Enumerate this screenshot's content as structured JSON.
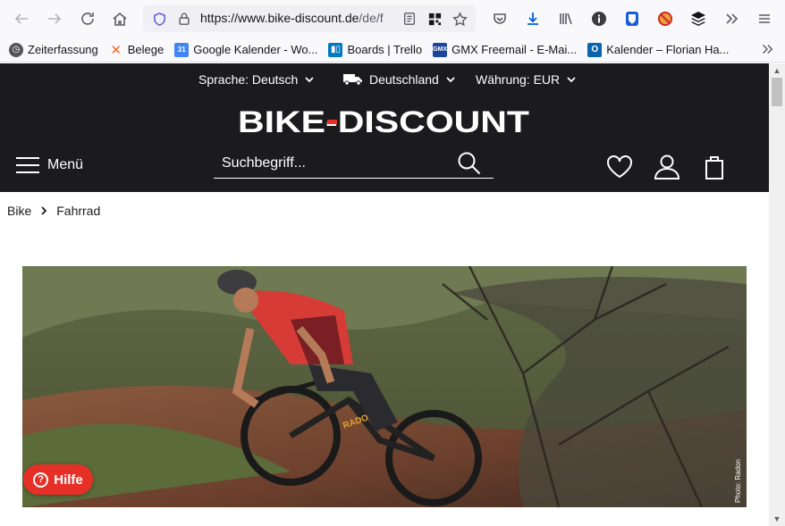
{
  "browser": {
    "url_host": "https://www.bike-discount.de",
    "url_path": "/de/f",
    "bookmarks": [
      {
        "label": "Zeiterfassung",
        "icon": "clock-icon",
        "color": "#555555"
      },
      {
        "label": "Belege",
        "icon": "x-logo-icon",
        "color": "#f26b21"
      },
      {
        "label": "Google Kalender - Wo...",
        "icon": "google-calendar-icon",
        "color": "#4285f4"
      },
      {
        "label": "Boards | Trello",
        "icon": "trello-icon",
        "color": "#0079bf"
      },
      {
        "label": "GMX Freemail - E-Mai...",
        "icon": "gmx-icon",
        "color": "#1c449b"
      },
      {
        "label": "Kalender – Florian Ha...",
        "icon": "outlook-icon",
        "color": "#0a64ad"
      }
    ]
  },
  "header": {
    "language": "Sprache: Deutsch",
    "country": "Deutschland",
    "currency": "Währung: EUR",
    "logo_text": "BIKE-DISCOUNT",
    "menu_label": "Menü",
    "search_placeholder": "Suchbegriff..."
  },
  "breadcrumb": {
    "items": [
      "Bike",
      "Fahrrad"
    ]
  },
  "hero": {
    "credit": "Photo: Radon"
  },
  "help": {
    "label": "Hilfe"
  },
  "colors": {
    "header_bg": "#1b1b1d",
    "accent_red": "#e63027"
  }
}
